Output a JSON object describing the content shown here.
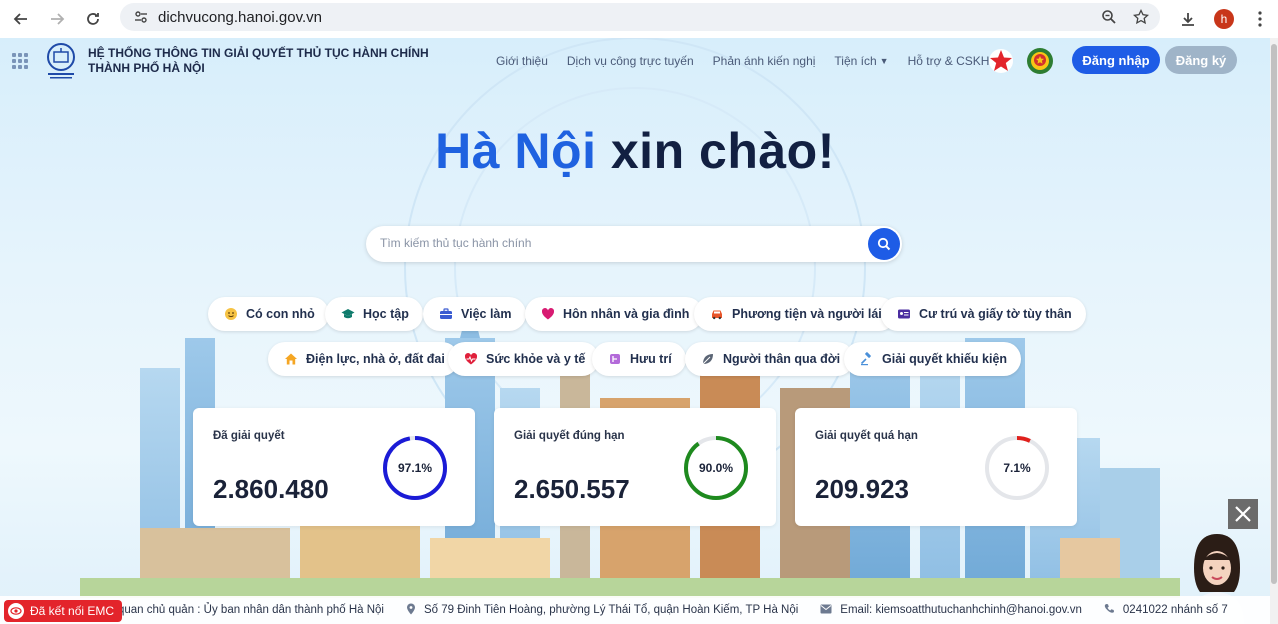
{
  "browser": {
    "url": "dichvucong.hanoi.gov.vn",
    "avatar_letter": "h"
  },
  "header": {
    "title_line1": "HỆ THỐNG THÔNG TIN GIẢI QUYẾT THỦ TỤC HÀNH CHÍNH",
    "title_line2": "THÀNH PHỐ HÀ NỘI",
    "menu": [
      {
        "label": "Giới thiệu"
      },
      {
        "label": "Dịch vụ công trực tuyến"
      },
      {
        "label": "Phản ánh kiến nghị"
      },
      {
        "label": "Tiện ích"
      },
      {
        "label": "Hỗ trợ & CSKH"
      }
    ],
    "login_label": "Đăng nhập",
    "register_label": "Đăng ký"
  },
  "hero": {
    "accent": "Hà Nội",
    "rest": " xin chào!"
  },
  "search": {
    "placeholder": "Tìm kiếm thủ tục hành chính"
  },
  "categories": [
    {
      "label": "Có con nhỏ",
      "icon": "baby-icon"
    },
    {
      "label": "Học tập",
      "icon": "graduation-cap-icon"
    },
    {
      "label": "Việc làm",
      "icon": "briefcase-icon"
    },
    {
      "label": "Hôn nhân và gia đình",
      "icon": "heart-icon"
    },
    {
      "label": "Phương tiện và người lái",
      "icon": "car-icon"
    },
    {
      "label": "Cư trú và giấy tờ tùy thân",
      "icon": "id-card-icon"
    },
    {
      "label": "Điện lực, nhà ở, đất đai",
      "icon": "house-icon"
    },
    {
      "label": "Sức khỏe và y tế",
      "icon": "heart-pulse-icon"
    },
    {
      "label": "Hưu trí",
      "icon": "retirement-icon"
    },
    {
      "label": "Người thân qua đời",
      "icon": "leaf-icon"
    },
    {
      "label": "Giải quyết khiếu kiện",
      "icon": "gavel-icon"
    }
  ],
  "stats": [
    {
      "label": "Đã giải quyết",
      "value": "2.860.480",
      "percent_text": "97.1%",
      "percent": 97.1,
      "color": "#1b1bd6"
    },
    {
      "label": "Giải quyết đúng hạn",
      "value": "2.650.557",
      "percent_text": "90.0%",
      "percent": 90.0,
      "color": "#1e8a1e"
    },
    {
      "label": "Giải quyết quá hạn",
      "value": "209.923",
      "percent_text": "7.1%",
      "percent": 7.1,
      "color": "#e0201c"
    }
  ],
  "footer": {
    "agency": "quan chủ quản : Ủy ban nhân dân thành phố Hà Nội",
    "address": "Số 79 Đinh Tiên Hoàng, phường Lý Thái Tổ, quận Hoàn Kiếm, TP Hà Nội",
    "email": "Email: kiemsoatthutuchanhchinh@hanoi.gov.vn",
    "phone": "0241022 nhánh số 7",
    "emc_label": "Đã kết nối EMC"
  },
  "colors": {
    "primary": "#1e5ce6",
    "hero_accent": "#1f62e0",
    "text_dark": "#122042"
  }
}
